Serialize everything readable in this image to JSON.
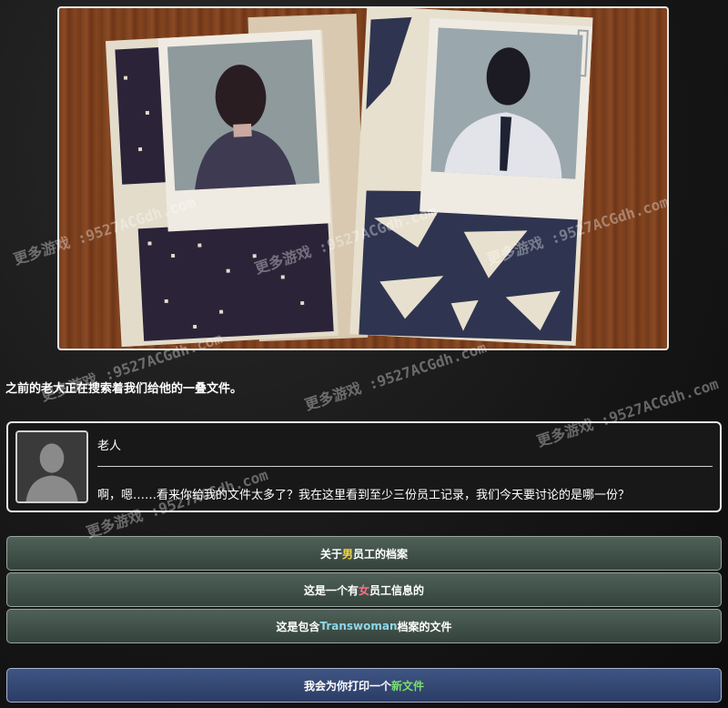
{
  "narration": "之前的老大正在搜索着我们给他的一叠文件。",
  "dialog": {
    "speaker": "老人",
    "text": "啊，嗯……看来你给我的文件太多了？我在这里看到至少三份员工记录，我们今天要讨论的是哪一份？"
  },
  "choices": [
    {
      "before": "关于",
      "highlight": "男",
      "after": "员工的档案",
      "color": "#f2d648"
    },
    {
      "before": "这是一个有",
      "highlight": "女",
      "after": "员工信息的",
      "color": "#ff6f86"
    },
    {
      "before": "这是包含",
      "highlight": "Transwoman",
      "after": "档案的文件",
      "color": "#8fd7e8"
    }
  ],
  "print_choice": {
    "before": "我会为你打印一个",
    "highlight": "新文件",
    "after": "",
    "color": "#7be06b"
  },
  "watermarks": [
    "更多游戏 :9527ACGdh.com",
    "更多游戏 :9527ACGdh.com",
    "更多游戏 :9527ACGdh.com",
    "更多游戏 :9527ACGdh.com",
    "更多游戏 :9527ACGdh.com",
    "更多游戏 :9527ACGdh.com",
    "更多游戏 :9527ACGdh.com"
  ]
}
